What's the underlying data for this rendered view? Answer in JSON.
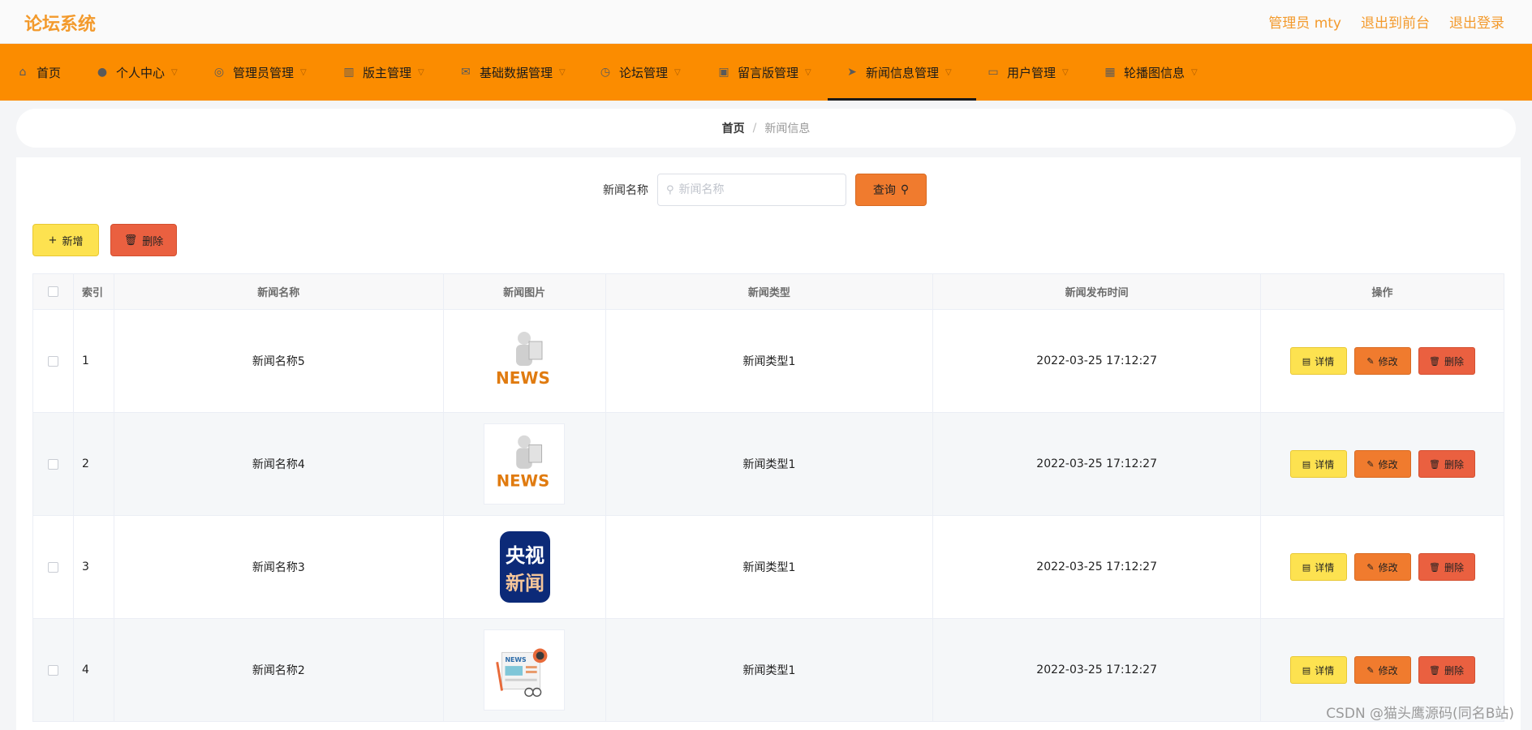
{
  "header": {
    "brand": "论坛系统",
    "links": [
      "管理员 mty",
      "退出到前台",
      "退出登录"
    ]
  },
  "nav": [
    {
      "label": "首页",
      "icon": "home-icon",
      "has_menu": false
    },
    {
      "label": "个人中心",
      "icon": "user-icon",
      "has_menu": true
    },
    {
      "label": "管理员管理",
      "icon": "compass-icon",
      "has_menu": true
    },
    {
      "label": "版主管理",
      "icon": "chart-icon",
      "has_menu": true
    },
    {
      "label": "基础数据管理",
      "icon": "mail-icon",
      "has_menu": true
    },
    {
      "label": "论坛管理",
      "icon": "clock-icon",
      "has_menu": true
    },
    {
      "label": "留言版管理",
      "icon": "camera-icon",
      "has_menu": true
    },
    {
      "label": "新闻信息管理",
      "icon": "send-icon",
      "has_menu": true,
      "active": true
    },
    {
      "label": "用户管理",
      "icon": "calendar-icon",
      "has_menu": true
    },
    {
      "label": "轮播图信息",
      "icon": "grid-icon",
      "has_menu": true
    }
  ],
  "breadcrumb": {
    "home": "首页",
    "separator": "/",
    "current": "新闻信息"
  },
  "search": {
    "label": "新闻名称",
    "placeholder": "新闻名称",
    "button": "查询"
  },
  "actions": {
    "add": "新增",
    "delete": "删除"
  },
  "table": {
    "headers": [
      "索引",
      "新闻名称",
      "新闻图片",
      "新闻类型",
      "新闻发布时间",
      "操作"
    ],
    "rows": [
      {
        "index": "1",
        "name": "新闻名称5",
        "image": "news-figure-image",
        "type": "新闻类型1",
        "time": "2022-03-25 17:12:27"
      },
      {
        "index": "2",
        "name": "新闻名称4",
        "image": "news-figure-image",
        "type": "新闻类型1",
        "time": "2022-03-25 17:12:27"
      },
      {
        "index": "3",
        "name": "新闻名称3",
        "image": "cctv-news-logo-image",
        "image_text_top": "央视",
        "image_text_bottom": "新闻",
        "type": "新闻类型1",
        "time": "2022-03-25 17:12:27"
      },
      {
        "index": "4",
        "name": "新闻名称2",
        "image": "newspaper-illustration-image",
        "image_text": "NEWS",
        "type": "新闻类型1",
        "time": "2022-03-25 17:12:27"
      }
    ],
    "row_buttons": {
      "detail": "详情",
      "edit": "修改",
      "delete": "删除"
    }
  },
  "watermark": "CSDN @猫头鹰源码(同名B站)",
  "colors": {
    "brand": "#f39a2c",
    "nav_bg": "#fb8c00",
    "btn_yellow": "#fde250",
    "btn_orange": "#f07b2e",
    "btn_red": "#ea6040"
  }
}
